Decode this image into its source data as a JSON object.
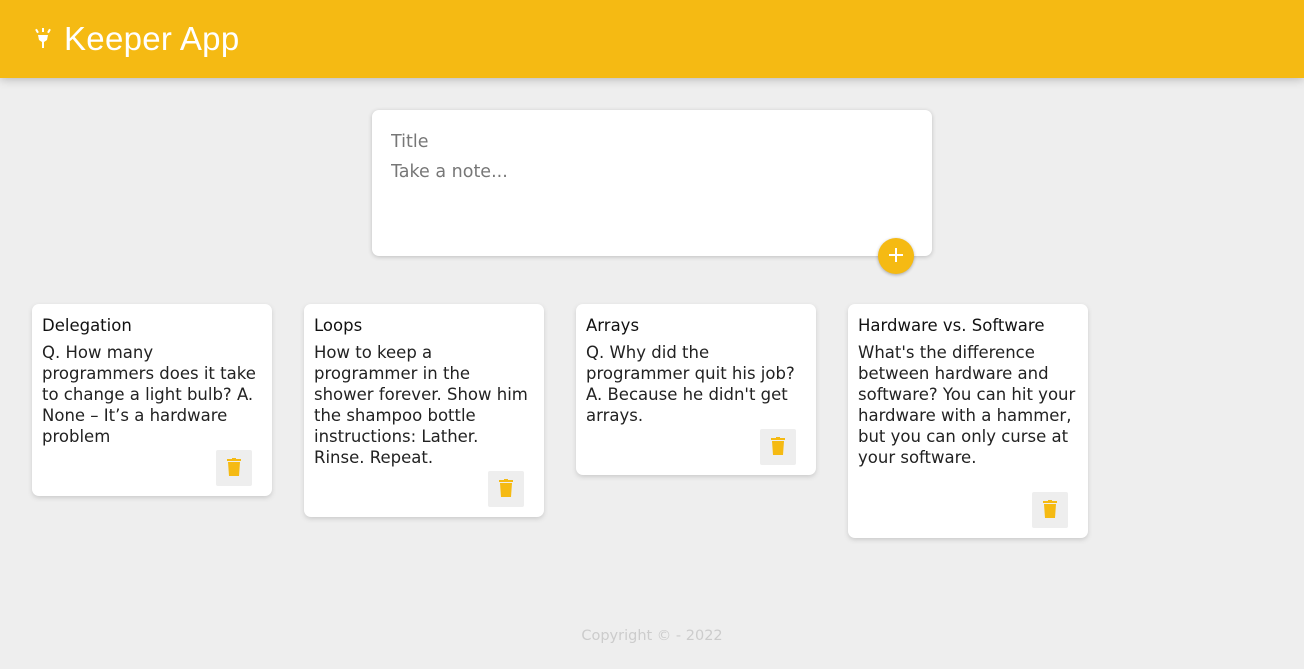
{
  "header": {
    "title": "Keeper App",
    "icon": "lightbulb-icon",
    "accent_color": "#f5ba13"
  },
  "create_note": {
    "title_placeholder": "Title",
    "content_placeholder": "Take a note...",
    "add_icon": "plus-icon"
  },
  "notes": [
    {
      "title": "Delegation",
      "content": "Q. How many programmers does it take to change a light bulb? A. None – It’s a hardware problem",
      "delete_icon": "trash-icon"
    },
    {
      "title": "Loops",
      "content": "How to keep a programmer in the shower forever. Show him the shampoo bottle instructions: Lather. Rinse. Repeat.",
      "delete_icon": "trash-icon"
    },
    {
      "title": "Arrays",
      "content": "Q. Why did the programmer quit his job? A. Because he didn't get arrays.",
      "delete_icon": "trash-icon"
    },
    {
      "title": "Hardware vs. Software",
      "content": "What's the difference between hardware and software? You can hit your hardware with a hammer, but you can only curse at your software.",
      "delete_icon": "trash-icon"
    }
  ],
  "footer": {
    "text": "Copyright © - 2022"
  }
}
